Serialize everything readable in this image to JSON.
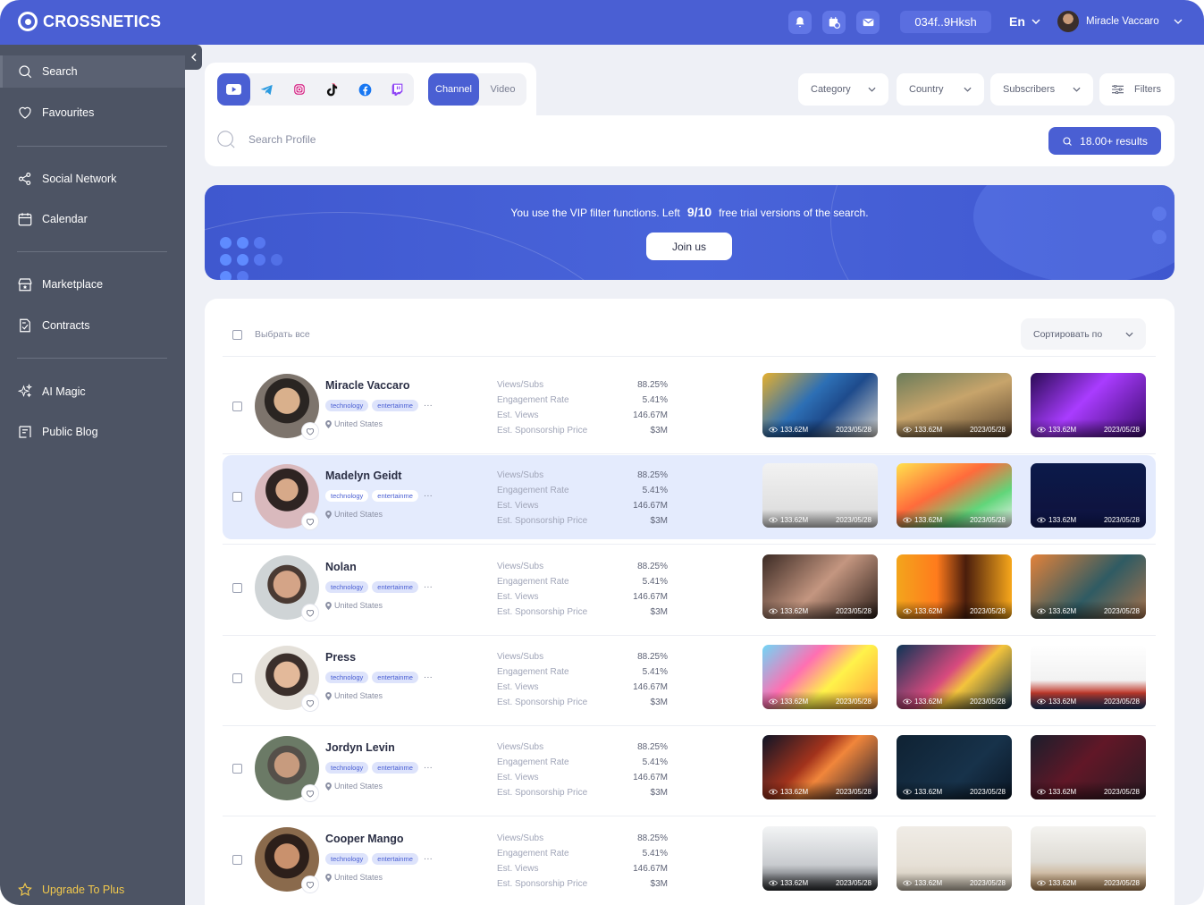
{
  "app": {
    "brand": "CROSSNETICS"
  },
  "header": {
    "wallet": "034f..9Hksh",
    "language": "En",
    "user_name": "Miracle Vaccaro"
  },
  "sidebar": {
    "items": [
      {
        "label": "Search",
        "icon": "search-icon",
        "active": true
      },
      {
        "label": "Favourites",
        "icon": "heart-icon"
      },
      {
        "label": "Social Network",
        "icon": "share-icon"
      },
      {
        "label": "Calendar",
        "icon": "calendar-icon"
      },
      {
        "label": "Marketplace",
        "icon": "store-icon"
      },
      {
        "label": "Contracts",
        "icon": "contract-icon"
      },
      {
        "label": "AI Magic",
        "icon": "sparkle-icon"
      },
      {
        "label": "Public Blog",
        "icon": "blog-icon"
      }
    ],
    "upgrade": "Upgrade To Plus"
  },
  "filters": {
    "platforms": [
      "youtube",
      "telegram",
      "instagram",
      "tiktok",
      "facebook",
      "twitch"
    ],
    "segments": {
      "channel": "Channel",
      "video": "Video"
    },
    "category": "Category",
    "country": "Country",
    "subscribers": "Subscribers",
    "filters": "Filters",
    "search_placeholder": "Search Profile",
    "results": "18.00+ results"
  },
  "banner": {
    "text_before": "You use the VIP filter functions. Left",
    "count": "9/10",
    "text_after": "free trial versions of the search.",
    "cta": "Join us"
  },
  "list": {
    "select_all": "Выбрать все",
    "sort": "Сортировать по",
    "stat_labels": [
      "Views/Subs",
      "Engagement Rate",
      "Est. Views",
      "Est. Sponsorship Price"
    ],
    "rows": [
      {
        "name": "Miracle Vaccaro",
        "tags": [
          "technology",
          "entertainme"
        ],
        "location": "United States",
        "stats": [
          "88.25%",
          "5.41%",
          "146.67M",
          "$3M"
        ],
        "thumbs": [
          {
            "views": "133.62M",
            "date": "2023/05/28"
          },
          {
            "views": "133.62M",
            "date": "2023/05/28"
          },
          {
            "views": "133.62M",
            "date": "2023/05/28"
          }
        ]
      },
      {
        "name": "Madelyn Geidt",
        "tags": [
          "technology",
          "entertainme"
        ],
        "location": "United States",
        "stats": [
          "88.25%",
          "5.41%",
          "146.67M",
          "$3M"
        ],
        "thumbs": [
          {
            "views": "133.62M",
            "date": "2023/05/28"
          },
          {
            "views": "133.62M",
            "date": "2023/05/28"
          },
          {
            "views": "133.62M",
            "date": "2023/05/28"
          }
        ]
      },
      {
        "name": "Nolan",
        "tags": [
          "technology",
          "entertainme"
        ],
        "location": "United States",
        "stats": [
          "88.25%",
          "5.41%",
          "146.67M",
          "$3M"
        ],
        "thumbs": [
          {
            "views": "133.62M",
            "date": "2023/05/28"
          },
          {
            "views": "133.62M",
            "date": "2023/05/28"
          },
          {
            "views": "133.62M",
            "date": "2023/05/28"
          }
        ]
      },
      {
        "name": "Press",
        "tags": [
          "technology",
          "entertainme"
        ],
        "location": "United States",
        "stats": [
          "88.25%",
          "5.41%",
          "146.67M",
          "$3M"
        ],
        "thumbs": [
          {
            "views": "133.62M",
            "date": "2023/05/28"
          },
          {
            "views": "133.62M",
            "date": "2023/05/28"
          },
          {
            "views": "133.62M",
            "date": "2023/05/28"
          }
        ]
      },
      {
        "name": "Jordyn Levin",
        "tags": [
          "technology",
          "entertainme"
        ],
        "location": "United States",
        "stats": [
          "88.25%",
          "5.41%",
          "146.67M",
          "$3M"
        ],
        "thumbs": [
          {
            "views": "133.62M",
            "date": "2023/05/28"
          },
          {
            "views": "133.62M",
            "date": "2023/05/28"
          },
          {
            "views": "133.62M",
            "date": "2023/05/28"
          }
        ]
      },
      {
        "name": "Cooper Mango",
        "tags": [
          "technology",
          "entertainme"
        ],
        "location": "United States",
        "stats": [
          "88.25%",
          "5.41%",
          "146.67M",
          "$3M"
        ],
        "thumbs": [
          {
            "views": "133.62M",
            "date": "2023/05/28"
          },
          {
            "views": "133.62M",
            "date": "2023/05/28"
          },
          {
            "views": "133.62M",
            "date": "2023/05/28"
          }
        ]
      }
    ]
  },
  "colors": {
    "primary": "#4a5fd3",
    "sidebar": "#4d5464",
    "highlight_row": "#e4ebfd",
    "upgrade": "#f2c94c"
  }
}
